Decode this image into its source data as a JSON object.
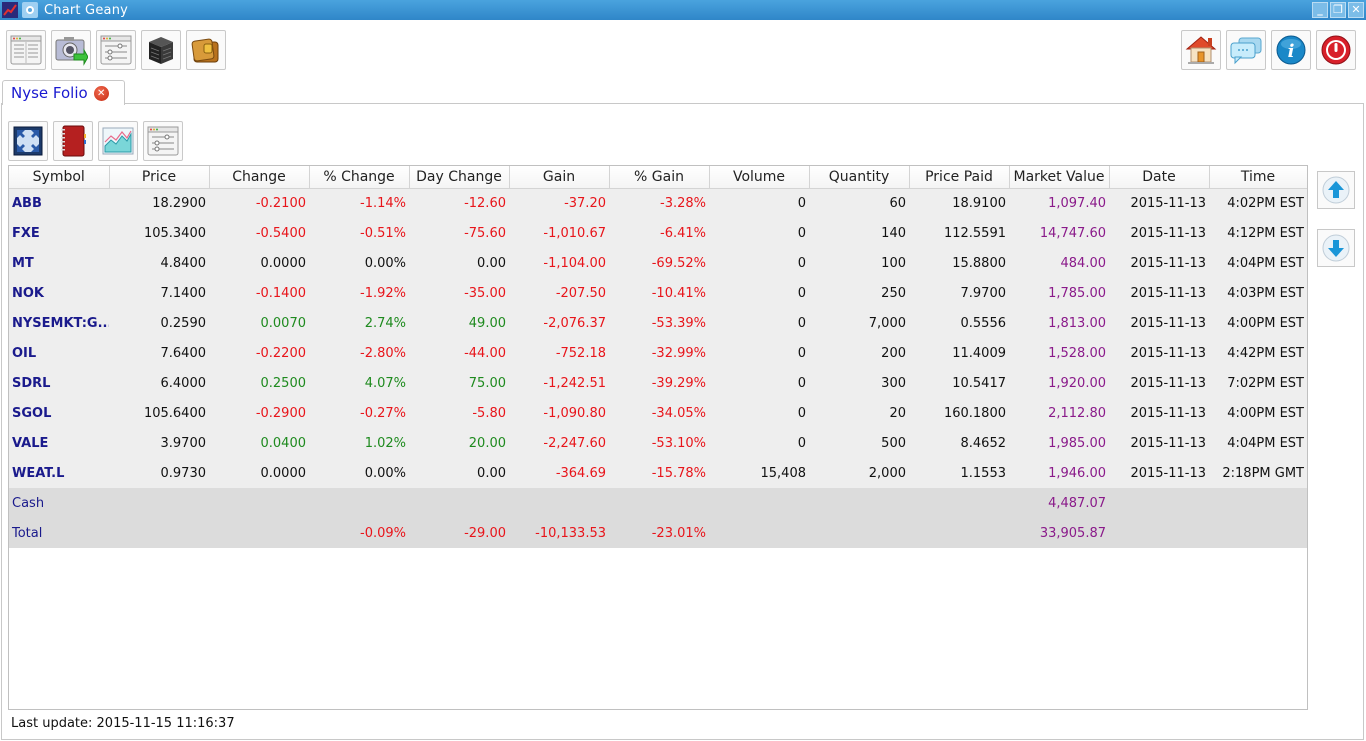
{
  "window": {
    "title": "Chart Geany",
    "app_icon": "chart-line-icon",
    "controls": [
      {
        "name": "minimize",
        "glyph": "_"
      },
      {
        "name": "restore",
        "glyph": "❐"
      },
      {
        "name": "close",
        "glyph": "✕"
      }
    ]
  },
  "main_toolbar": {
    "left": [
      {
        "name": "portfolio-list",
        "icon": "document-list-icon"
      },
      {
        "name": "screenshot",
        "icon": "camera-icon"
      },
      {
        "name": "settings",
        "icon": "sliders-icon"
      },
      {
        "name": "database",
        "icon": "database-cube-icon"
      },
      {
        "name": "wallet",
        "icon": "wallet-icon"
      }
    ],
    "right": [
      {
        "name": "home",
        "icon": "home-icon"
      },
      {
        "name": "chat",
        "icon": "chat-bubbles-icon"
      },
      {
        "name": "info",
        "icon": "info-icon"
      },
      {
        "name": "power",
        "icon": "power-icon"
      }
    ]
  },
  "tabs": [
    {
      "label": "Nyse Folio",
      "active": true,
      "closable": true
    }
  ],
  "sub_toolbar": [
    {
      "name": "fullscreen",
      "icon": "expand-arrows-icon"
    },
    {
      "name": "portfolio-book",
      "icon": "portfolio-book-icon"
    },
    {
      "name": "chart",
      "icon": "area-chart-icon"
    },
    {
      "name": "preferences",
      "icon": "sliders-icon"
    }
  ],
  "table": {
    "columns": [
      "Symbol",
      "Price",
      "Change",
      "% Change",
      "Day Change",
      "Gain",
      "% Gain",
      "Volume",
      "Quantity",
      "Price Paid",
      "Market Value",
      "Date",
      "Time"
    ],
    "rows": [
      {
        "symbol": "ABB",
        "price": "18.2900",
        "change": "-0.2100",
        "pct_change": "-1.14%",
        "day_change": "-12.60",
        "gain": "-37.20",
        "pct_gain": "-3.28%",
        "volume": "0",
        "quantity": "60",
        "price_paid": "18.9100",
        "market_value": "1,097.40",
        "date": "2015-11-13",
        "time": "4:02PM EST"
      },
      {
        "symbol": "FXE",
        "price": "105.3400",
        "change": "-0.5400",
        "pct_change": "-0.51%",
        "day_change": "-75.60",
        "gain": "-1,010.67",
        "pct_gain": "-6.41%",
        "volume": "0",
        "quantity": "140",
        "price_paid": "112.5591",
        "market_value": "14,747.60",
        "date": "2015-11-13",
        "time": "4:12PM EST"
      },
      {
        "symbol": "MT",
        "price": "4.8400",
        "change": "0.0000",
        "pct_change": "0.00%",
        "day_change": "0.00",
        "gain": "-1,104.00",
        "pct_gain": "-69.52%",
        "volume": "0",
        "quantity": "100",
        "price_paid": "15.8800",
        "market_value": "484.00",
        "date": "2015-11-13",
        "time": "4:04PM EST"
      },
      {
        "symbol": "NOK",
        "price": "7.1400",
        "change": "-0.1400",
        "pct_change": "-1.92%",
        "day_change": "-35.00",
        "gain": "-207.50",
        "pct_gain": "-10.41%",
        "volume": "0",
        "quantity": "250",
        "price_paid": "7.9700",
        "market_value": "1,785.00",
        "date": "2015-11-13",
        "time": "4:03PM EST"
      },
      {
        "symbol": "NYSEMKT:G...",
        "price": "0.2590",
        "change": "0.0070",
        "pct_change": "2.74%",
        "day_change": "49.00",
        "gain": "-2,076.37",
        "pct_gain": "-53.39%",
        "volume": "0",
        "quantity": "7,000",
        "price_paid": "0.5556",
        "market_value": "1,813.00",
        "date": "2015-11-13",
        "time": "4:00PM EST"
      },
      {
        "symbol": "OIL",
        "price": "7.6400",
        "change": "-0.2200",
        "pct_change": "-2.80%",
        "day_change": "-44.00",
        "gain": "-752.18",
        "pct_gain": "-32.99%",
        "volume": "0",
        "quantity": "200",
        "price_paid": "11.4009",
        "market_value": "1,528.00",
        "date": "2015-11-13",
        "time": "4:42PM EST"
      },
      {
        "symbol": "SDRL",
        "price": "6.4000",
        "change": "0.2500",
        "pct_change": "4.07%",
        "day_change": "75.00",
        "gain": "-1,242.51",
        "pct_gain": "-39.29%",
        "volume": "0",
        "quantity": "300",
        "price_paid": "10.5417",
        "market_value": "1,920.00",
        "date": "2015-11-13",
        "time": "7:02PM EST"
      },
      {
        "symbol": "SGOL",
        "price": "105.6400",
        "change": "-0.2900",
        "pct_change": "-0.27%",
        "day_change": "-5.80",
        "gain": "-1,090.80",
        "pct_gain": "-34.05%",
        "volume": "0",
        "quantity": "20",
        "price_paid": "160.1800",
        "market_value": "2,112.80",
        "date": "2015-11-13",
        "time": "4:00PM EST"
      },
      {
        "symbol": "VALE",
        "price": "3.9700",
        "change": "0.0400",
        "pct_change": "1.02%",
        "day_change": "20.00",
        "gain": "-2,247.60",
        "pct_gain": "-53.10%",
        "volume": "0",
        "quantity": "500",
        "price_paid": "8.4652",
        "market_value": "1,985.00",
        "date": "2015-11-13",
        "time": "4:04PM EST"
      },
      {
        "symbol": "WEAT.L",
        "price": "0.9730",
        "change": "0.0000",
        "pct_change": "0.00%",
        "day_change": "0.00",
        "gain": "-364.69",
        "pct_gain": "-15.78%",
        "volume": "15,408",
        "quantity": "2,000",
        "price_paid": "1.1553",
        "market_value": "1,946.00",
        "date": "2015-11-13",
        "time": "2:18PM GMT"
      }
    ],
    "summary": [
      {
        "symbol": "Cash",
        "price": "",
        "change": "",
        "pct_change": "",
        "day_change": "",
        "gain": "",
        "pct_gain": "",
        "volume": "",
        "quantity": "",
        "price_paid": "",
        "market_value": "4,487.07",
        "date": "",
        "time": ""
      },
      {
        "symbol": "Total",
        "price": "",
        "change": "",
        "pct_change": "-0.09%",
        "day_change": "-29.00",
        "gain": "-10,133.53",
        "pct_gain": "-23.01%",
        "volume": "",
        "quantity": "",
        "price_paid": "",
        "market_value": "33,905.87",
        "date": "",
        "time": ""
      }
    ]
  },
  "side_buttons": [
    {
      "name": "move-up",
      "icon": "arrow-up-icon"
    },
    {
      "name": "move-down",
      "icon": "arrow-down-icon"
    }
  ],
  "status": {
    "last_update": "Last update: 2015-11-15 11:16:37"
  },
  "colors": {
    "negative": "#e8141a",
    "positive": "#1e8a1e",
    "market_value": "#8a1a8a",
    "symbol": "#1a1a8c",
    "titlebar": "#3a92d2",
    "tab_label": "#1a1ad0"
  }
}
